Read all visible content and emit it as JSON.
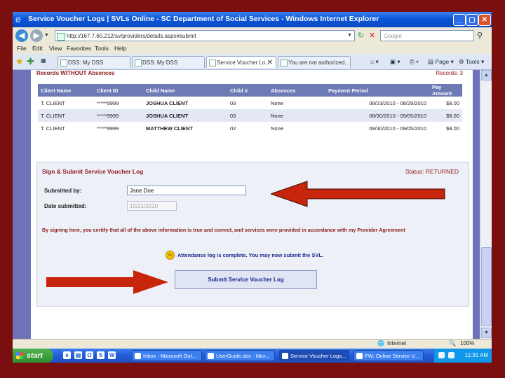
{
  "window": {
    "title": "Service Voucher Logs | SVLs Online - SC Department of Social Services - Windows Internet Explorer"
  },
  "toolbar": {
    "address": "http://167.7.60.212/sv/providers/details.aspx#submit",
    "search_placeholder": "Google"
  },
  "menu": [
    "File",
    "Edit",
    "View",
    "Favorites",
    "Tools",
    "Help"
  ],
  "tabs": [
    {
      "label": "DSS: My DSS"
    },
    {
      "label": "DSS: My DSS"
    },
    {
      "label": "Service Voucher Lo...",
      "active": true
    },
    {
      "label": "You are not authorized..."
    }
  ],
  "tools": {
    "page": "Page",
    "tools": "Tools"
  },
  "records_section": {
    "title": "Records WITHOUT Absences",
    "count_label": "Records: 3",
    "columns": [
      "Client Name",
      "Client ID",
      "Child Name",
      "Child #",
      "Absences",
      "Payment Period",
      "Pay Amount"
    ],
    "rows": [
      [
        "T. CLIENT",
        "*****9999",
        "JOSHUA CLIENT",
        "03",
        "None",
        "08/23/2010 - 08/29/2010",
        "$8.00"
      ],
      [
        "T. CLIENT",
        "*****9999",
        "JOSHUA CLIENT",
        "03",
        "None",
        "08/30/2010 - 09/05/2010",
        "$8.00"
      ],
      [
        "T. CLIENT",
        "*****9999",
        "MATTHEW CLIENT",
        "02",
        "None",
        "08/30/2010 - 09/05/2010",
        "$8.00"
      ]
    ]
  },
  "sign_section": {
    "title": "Sign & Submit Service Voucher Log",
    "status": "Status: RETURNED",
    "submitted_by_label": "Submitted by:",
    "submitted_by_value": "Jane Doe",
    "date_label": "Date submitted:",
    "date_value": "10/21/2010",
    "certification": "By signing here, you certify that all of the above information is true and correct, and services were provided in accordance with my Provider Agreement",
    "complete_message": "Attendance log is complete. You may now submit the SVL.",
    "submit_label": "Submit Service Voucher Log"
  },
  "statusbar": {
    "zone": "Internet",
    "zoom": "100%"
  },
  "taskbar": {
    "start": "start",
    "buttons": [
      {
        "label": "Inbox - Microsoft Out..."
      },
      {
        "label": "UserGuide.doc - Micr..."
      },
      {
        "label": "Service Voucher Logs...",
        "active": true
      },
      {
        "label": "FW: Online Service V..."
      }
    ],
    "clock": "11:31 AM"
  },
  "colors": {
    "frame": "#7a0f10",
    "arrow": "#c8260c",
    "accent": "#8b1a1a",
    "header": "#6c7ab5"
  }
}
